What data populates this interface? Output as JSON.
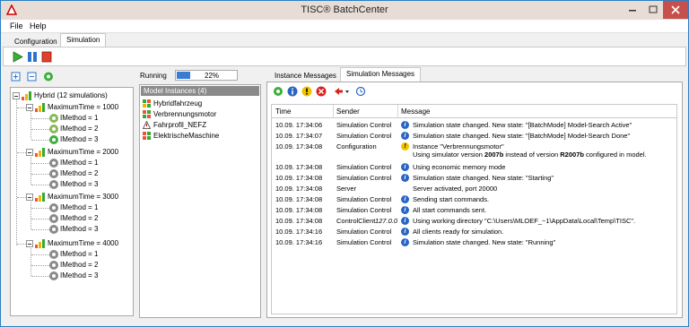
{
  "window": {
    "title": "TISC® BatchCenter"
  },
  "menu": {
    "file": "File",
    "help": "Help"
  },
  "tabs": {
    "configuration": "Configuration",
    "simulation": "Simulation"
  },
  "tree": {
    "root": "Hybrid (12 simulations)",
    "groups": [
      {
        "label": "MaximumTime = 1000",
        "items": [
          "IMethod = 1",
          "IMethod = 2",
          "IMethod = 3"
        ]
      },
      {
        "label": "MaximumTime = 2000",
        "items": [
          "IMethod = 1",
          "IMethod = 2",
          "IMethod = 3"
        ]
      },
      {
        "label": "MaximumTime = 3000",
        "items": [
          "IMethod = 1",
          "IMethod = 2",
          "IMethod = 3"
        ]
      },
      {
        "label": "MaximumTime = 4000",
        "items": [
          "IMethod = 1",
          "IMethod = 2",
          "IMethod = 3"
        ]
      }
    ]
  },
  "progress": {
    "label": "Running",
    "value_text": "22%",
    "value": 0.22
  },
  "models": {
    "header": "Model Instances (4)",
    "items": [
      "Hybridfahrzeug",
      "Verbrennungsmotor",
      "Fahrprofil_NEFZ",
      "ElektrischeMaschine"
    ]
  },
  "msgtabs": {
    "instance": "Instance Messages",
    "simulation": "Simulation Messages"
  },
  "grid": {
    "headers": {
      "time": "Time",
      "sender": "Sender",
      "message": "Message"
    },
    "rows": [
      {
        "time": "10.09. 17:34:06",
        "sender": "Simulation Control",
        "type": "info",
        "message": "Simulation state changed. New state: \"[BatchMode] Model-Search Active\""
      },
      {
        "time": "10.09. 17:34:07",
        "sender": "Simulation Control",
        "type": "info",
        "message": "Simulation state changed. New state: \"[BatchMode] Model-Search Done\""
      },
      {
        "time": "10.09. 17:34:08",
        "sender": "Configuration",
        "type": "warn",
        "message": "Instance \"Verbrennungsmotor\""
      },
      {
        "time": "10.09. 17:34:08",
        "sender": "Simulation Control",
        "type": "info",
        "message": "Using economic memory mode"
      },
      {
        "time": "10.09. 17:34:08",
        "sender": "Simulation Control",
        "type": "info",
        "message": "Simulation state changed. New state: \"Starting\""
      },
      {
        "time": "10.09. 17:34:08",
        "sender": "Server",
        "type": "none",
        "message": "Server activated, port 20000"
      },
      {
        "time": "10.09. 17:34:08",
        "sender": "Simulation Control",
        "type": "info",
        "message": "Sending start commands."
      },
      {
        "time": "10.09. 17:34:08",
        "sender": "Simulation Control",
        "type": "info",
        "message": "All start commands sent."
      },
      {
        "time": "10.09. 17:34:08",
        "sender": "ControlClient",
        "type": "info",
        "message": "Using working directory \"C:\\Users\\MLOEF_~1\\AppData\\Local\\Temp\\TISC\"."
      },
      {
        "time": "10.09. 17:34:16",
        "sender": "Simulation Control",
        "type": "info",
        "message": "All clients ready for simulation."
      },
      {
        "time": "10.09. 17:34:16",
        "sender": "Simulation Control",
        "type": "info",
        "message": "Simulation state changed. New state: \"Running\""
      }
    ],
    "controlclient_host": "127.0.0",
    "warn_line2": {
      "pre": "Using simulator version ",
      "ver1": "2007b",
      "mid": " instead of version ",
      "ver2": "R2007b",
      "post": " configured in model."
    }
  }
}
